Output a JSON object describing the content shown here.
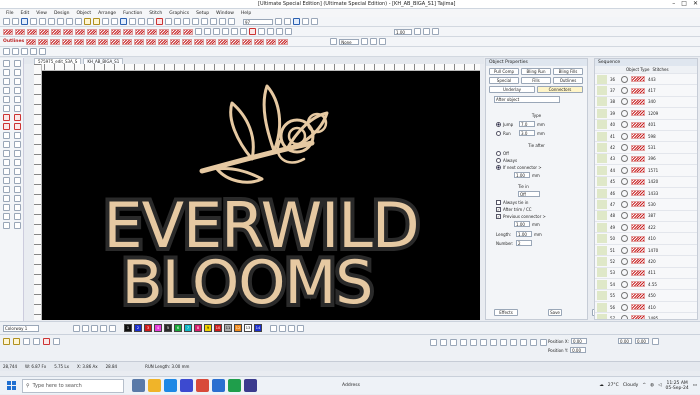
{
  "window": {
    "title": "[Ultimate Special Edition] (Ultimate Special Edition) - [KH_AB_BIGA_S1] Tajima]"
  },
  "menu": [
    "File",
    "Edit",
    "View",
    "Design",
    "Object",
    "Arrange",
    "Function",
    "Stitch",
    "Graphics",
    "Setup",
    "Window",
    "Help"
  ],
  "toolbar": {
    "outlines_label": "Outlines",
    "zoom_value": "97",
    "none_label": "None",
    "value_1_00": "1.00"
  },
  "tabs": [
    "575975_edit_S3A_S",
    "KH_AB_BIGA_S1"
  ],
  "design": {
    "line1": "EVERWILD",
    "line2": "BLOOMS",
    "thread_color": "#e6c9a2",
    "outline_color": "#2a2a2a"
  },
  "panel": {
    "title": "Object Properties",
    "tabs_row1": [
      "Pull Comp",
      "Bling Run",
      "Bling Fills"
    ],
    "tabs_row2": [
      "Special",
      "Fills",
      "Outlines"
    ],
    "tabs_row3": [
      "Underlay",
      "Connectors"
    ],
    "connector_mode": "After object",
    "type_label": "Type",
    "jump_label": "Jump",
    "jump_value": "7.0",
    "run_label": "Run",
    "run_value": "3.0",
    "unit": "mm",
    "tie_after_label": "Tie after",
    "tie_off_label": "Off",
    "tie_always_label": "Always",
    "tie_if_label": "If next connector >",
    "tie_if_value": "1.00",
    "tie_in_label": "Tie in",
    "tie_in_select": "Off",
    "chk_always_tie": "Always tie in",
    "chk_after_trim": "After trim / CC",
    "chk_prev": "Previous connector >",
    "prev_value": "1.00",
    "length_label": "Length:",
    "length_value": "1.00",
    "number_label": "Number:",
    "number_value": "2",
    "effects_btn": "Effects",
    "save_btn": "Save"
  },
  "sequence": {
    "title": "Sequence",
    "col_object": "Object Type",
    "col_stitches": "Stitches",
    "rows": [
      {
        "id": "36",
        "stitches": "443"
      },
      {
        "id": "37",
        "stitches": "417"
      },
      {
        "id": "38",
        "stitches": "340"
      },
      {
        "id": "39",
        "stitches": "1209"
      },
      {
        "id": "40",
        "stitches": "401"
      },
      {
        "id": "41",
        "stitches": "598"
      },
      {
        "id": "42",
        "stitches": "531"
      },
      {
        "id": "43",
        "stitches": "396"
      },
      {
        "id": "44",
        "stitches": "1571"
      },
      {
        "id": "45",
        "stitches": "1420"
      },
      {
        "id": "46",
        "stitches": "1433"
      },
      {
        "id": "47",
        "stitches": "530"
      },
      {
        "id": "48",
        "stitches": "387"
      },
      {
        "id": "49",
        "stitches": "422"
      },
      {
        "id": "50",
        "stitches": "410"
      },
      {
        "id": "51",
        "stitches": "1470"
      },
      {
        "id": "52",
        "stitches": "420"
      },
      {
        "id": "53",
        "stitches": "411"
      },
      {
        "id": "54",
        "stitches": "4.55"
      },
      {
        "id": "55",
        "stitches": "450"
      },
      {
        "id": "56",
        "stitches": "410"
      },
      {
        "id": "57",
        "stitches": "1485"
      }
    ]
  },
  "palette": {
    "colorway": "Colorway 1",
    "swatches": [
      {
        "n": "1",
        "c": "#111111"
      },
      {
        "n": "2",
        "c": "#1b2fd0"
      },
      {
        "n": "3",
        "c": "#d01b1b"
      },
      {
        "n": "4",
        "c": "#e53ad8"
      },
      {
        "n": "5",
        "c": "#2a2a2a"
      },
      {
        "n": "6",
        "c": "#19a93b"
      },
      {
        "n": "7",
        "c": "#0fb8c7"
      },
      {
        "n": "8",
        "c": "#d81e6e"
      },
      {
        "n": "9",
        "c": "#f0d000"
      },
      {
        "n": "10",
        "c": "#d01b1b"
      },
      {
        "n": "11",
        "c": "#aaaaaa"
      },
      {
        "n": "12",
        "c": "#f08a1b"
      },
      {
        "n": "13",
        "c": "#ffffff"
      },
      {
        "n": "14",
        "c": "#1b2fd0"
      }
    ]
  },
  "bottom": {
    "position_x_label": "Position X:",
    "position_y_label": "Position Y:",
    "position_x_value": "0.00",
    "position_y_value": "0.00"
  },
  "status": {
    "stitches": "28,744",
    "w": "W: 6.87 Fx",
    "h": "5.75 Lx",
    "x": "X: 3.86 Ax",
    "y": "28.84",
    "run_length": "RUN Length: 3.00 mm"
  },
  "taskbar": {
    "search_placeholder": "Type here to search",
    "address_label": "Address",
    "weather": "27°C",
    "weather_desc": "Cloudy",
    "time": "11:25 AM",
    "date": "05-Sep-24"
  }
}
